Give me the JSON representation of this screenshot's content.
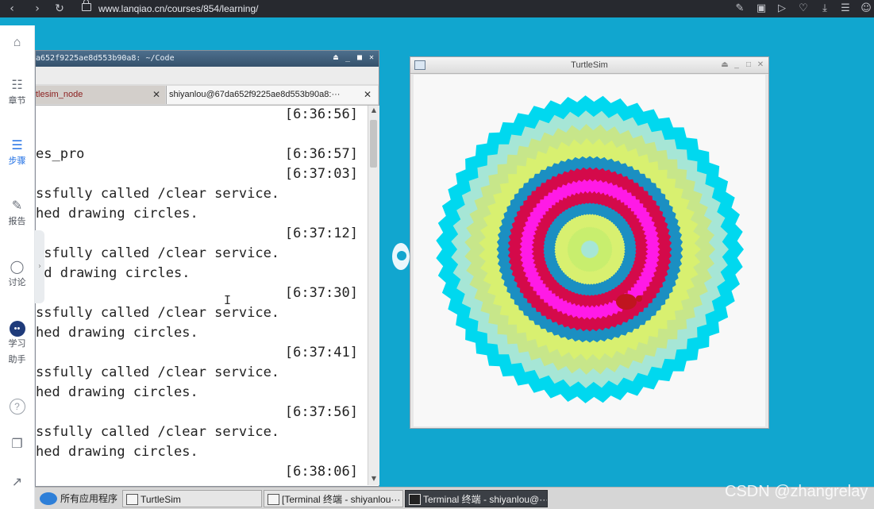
{
  "browser": {
    "url": "www.lanqiao.cn/courses/854/learning/",
    "nav_icons": [
      "back-icon",
      "forward-icon",
      "reload-icon",
      "lock-icon"
    ],
    "right_icons": [
      "edit-icon",
      "camera-icon",
      "play-icon",
      "heart-icon",
      "download-icon",
      "menu-icon",
      "user-icon"
    ]
  },
  "sidebar": {
    "items": [
      {
        "icon": "home-icon",
        "label": ""
      },
      {
        "icon": "chapters-icon",
        "label": "章节"
      },
      {
        "icon": "steps-icon",
        "label": "步骤"
      },
      {
        "icon": "report-icon",
        "label": "报告"
      },
      {
        "icon": "discussion-icon",
        "label": "讨论"
      },
      {
        "icon": "assistant-icon",
        "label_line1": "学习",
        "label_line2": "助手"
      },
      {
        "icon": "help-icon",
        "label": ""
      },
      {
        "icon": "document-icon",
        "label": ""
      },
      {
        "icon": "stairs-icon",
        "label": ""
      }
    ],
    "active": "步骤"
  },
  "terminal": {
    "title": "a652f9225ae8d553b90a8: ~/Code",
    "tabs": [
      {
        "label": "tlesim_node",
        "active": false
      },
      {
        "label": "shiyanlou@67da652f9225ae8d553b90a8:···",
        "active": true
      }
    ],
    "lines": [
      {
        "text": "",
        "time": "[6:36:56]"
      },
      {
        "text": "",
        "time": ""
      },
      {
        "text": "es_pro",
        "time": "[6:36:57]"
      },
      {
        "text": "",
        "time": "[6:37:03]"
      },
      {
        "text": "ssfully called /clear service.",
        "time": ""
      },
      {
        "text": "hed drawing circles.",
        "time": ""
      },
      {
        "text": "",
        "time": "[6:37:12]"
      },
      {
        "text": "ssfully called /clear service.",
        "time": ""
      },
      {
        "text": "ed drawing circles.",
        "time": ""
      },
      {
        "text": "",
        "time": "[6:37:30]"
      },
      {
        "text": "ssfully called /clear service.",
        "time": ""
      },
      {
        "text": "hed drawing circles.",
        "time": ""
      },
      {
        "text": "",
        "time": "[6:37:41]"
      },
      {
        "text": "ssfully called /clear service.",
        "time": ""
      },
      {
        "text": "hed drawing circles.",
        "time": ""
      },
      {
        "text": "",
        "time": "[6:37:56]"
      },
      {
        "text": "ssfully called /clear service.",
        "time": ""
      },
      {
        "text": "hed drawing circles.",
        "time": ""
      },
      {
        "text": "",
        "time": "[6:38:06]"
      }
    ]
  },
  "turtlesim": {
    "title": "TurtleSim",
    "background": "#f8f8f8",
    "rings": [
      {
        "color": "#00d8ef"
      },
      {
        "color": "#a6e6d6"
      },
      {
        "color": "#c7e68a"
      },
      {
        "color": "#d8f070"
      },
      {
        "color": "#1b8fc2"
      },
      {
        "color": "#d40a4a"
      },
      {
        "color": "#ff1ae6"
      },
      {
        "color": "#d40a4a"
      },
      {
        "color": "#1b8fc2"
      },
      {
        "color": "#d8f070"
      },
      {
        "color": "#c8ee6e"
      },
      {
        "color": "#a6e6d6"
      },
      {
        "color": "#00d8ef"
      }
    ],
    "turtle_color": "#c0151f"
  },
  "taskbar": {
    "start_label": "所有应用程序",
    "tasks": [
      {
        "label": "TurtleSim",
        "active": false
      },
      {
        "label": "[Terminal 终端 - shiyanlou···",
        "active": false
      },
      {
        "label": "Terminal 终端 - shiyanlou@···",
        "active": true
      }
    ]
  },
  "watermark": "CSDN @zhangrelay"
}
